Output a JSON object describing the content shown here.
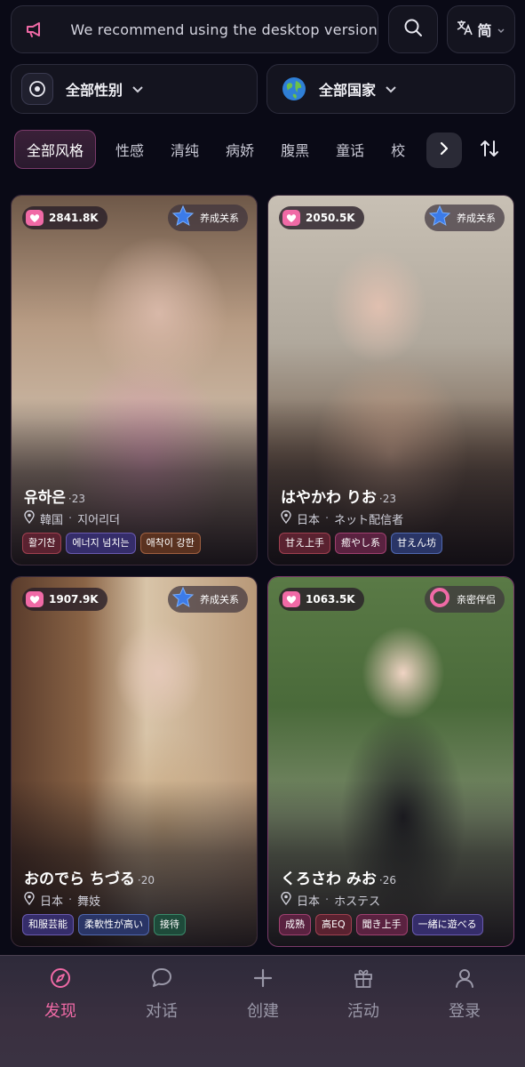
{
  "banner": {
    "text": "We recommend using the desktop version",
    "icon": "megaphone-icon"
  },
  "search": {
    "icon": "search-icon"
  },
  "language": {
    "label": "简",
    "icon": "translate-icon"
  },
  "filters": {
    "gender": {
      "label": "全部性别",
      "icon": "gender-icon"
    },
    "country": {
      "label": "全部国家",
      "icon": "globe-icon"
    }
  },
  "style_tabs": {
    "items": [
      "全部风格",
      "性感",
      "清纯",
      "病娇",
      "腹黑",
      "童话",
      "校"
    ],
    "active": "全部风格"
  },
  "cards": [
    {
      "likes": "2841.8K",
      "relation": "养成关系",
      "relation_icon": "star-icon",
      "name": "유하은",
      "age": "·23",
      "country": "韓国",
      "occupation": "지어리더",
      "tags": [
        "활기찬",
        "에너지 넘치는",
        "애착이 강한"
      ]
    },
    {
      "likes": "2050.5K",
      "relation": "养成关系",
      "relation_icon": "star-icon",
      "name": "はやかわ りお",
      "age": "·23",
      "country": "日本",
      "occupation": "ネット配信者",
      "tags": [
        "甘え上手",
        "癒やし系",
        "甘えん坊"
      ]
    },
    {
      "likes": "1907.9K",
      "relation": "养成关系",
      "relation_icon": "star-icon",
      "name": "おのでら ちづる",
      "age": "·20",
      "country": "日本",
      "occupation": "舞妓",
      "tags": [
        "和服芸能",
        "柔軟性が高い",
        "接待"
      ]
    },
    {
      "likes": "1063.5K",
      "relation": "亲密伴侣",
      "relation_icon": "ring-icon",
      "name": "くろさわ みお",
      "age": "·26",
      "country": "日本",
      "occupation": "ホステス",
      "tags": [
        "成熟",
        "高EQ",
        "聞き上手",
        "一緒に遊べる"
      ]
    }
  ],
  "nav": {
    "items": [
      "发现",
      "对话",
      "创建",
      "活动",
      "登录"
    ],
    "active": "发现"
  },
  "colors": {
    "accent": "#f06aa6",
    "background": "#0a0a16"
  }
}
